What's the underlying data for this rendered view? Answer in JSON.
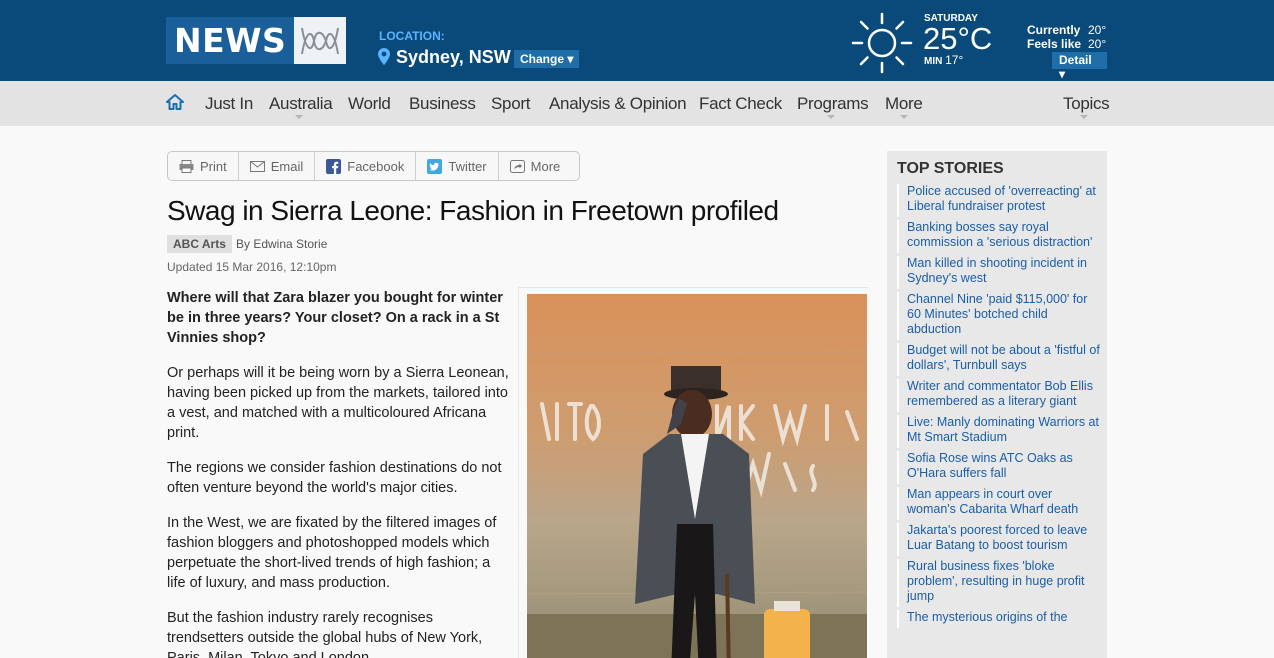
{
  "header": {
    "logo_text": "NEWS",
    "location_label": "LOCATION:",
    "location_city": "Sydney, NSW",
    "change_label": "Change",
    "weather": {
      "day": "SATURDAY",
      "temp": "25°C",
      "min_label": "MIN",
      "min_value": "17°",
      "currently_label": "Currently",
      "currently_value": "20°",
      "feels_label": "Feels like",
      "feels_value": "20°",
      "detail_label": "Detail"
    },
    "colors": {
      "bar": "#0a4a7a",
      "accent": "#58b4ff"
    }
  },
  "nav": {
    "items": [
      "Just In",
      "Australia",
      "World",
      "Business",
      "Sport",
      "Analysis & Opinion",
      "Fact Check",
      "Programs",
      "More"
    ],
    "topics": "Topics"
  },
  "share": [
    "Print",
    "Email",
    "Facebook",
    "Twitter",
    "More"
  ],
  "article": {
    "title": "Swag in Sierra Leone: Fashion in Freetown profiled",
    "tag": "ABC Arts",
    "byline": "By Edwina Storie",
    "updated": "Updated 15 Mar 2016, 12:10pm",
    "paragraphs": [
      "Where will that Zara blazer you bought for winter be in three years? Your closet? On a rack in a St Vinnies shop?",
      "Or perhaps will it be being worn by a Sierra Leonean, having been picked up from the markets, tailored into a vest, and matched with a multicoloured Africana print.",
      "The regions we consider fashion destinations do not often venture beyond the world's major cities.",
      "In the West, we are fixated by the filtered images of fashion bloggers and photoshopped models which perpetuate the short-lived trends of high fashion; a life of luxury, and mass production.",
      "But the fashion industry rarely recognises trendsetters outside the global hubs of New York, Paris, Milan, Tokyo and London."
    ]
  },
  "sidebar": {
    "title": "TOP STORIES",
    "stories": [
      "Police accused of 'overreacting' at Liberal fundraiser protest",
      "Banking bosses say royal commission a 'serious distraction'",
      "Man killed in shooting incident in Sydney's west",
      "Channel Nine 'paid $115,000' for 60 Minutes' botched child abduction",
      "Budget will not be about a 'fistful of dollars', Turnbull says",
      "Writer and commentator Bob Ellis remembered as a literary giant",
      "Live: Manly dominating Warriors at Mt Smart Stadium",
      "Sofia Rose wins ATC Oaks as O'Hara suffers fall",
      "Man appears in court over woman's Cabarita Wharf death",
      "Jakarta's poorest forced to leave Luar Batang to boost tourism",
      "Rural business fixes 'bloke problem', resulting in huge profit jump",
      "The mysterious origins of the"
    ]
  }
}
